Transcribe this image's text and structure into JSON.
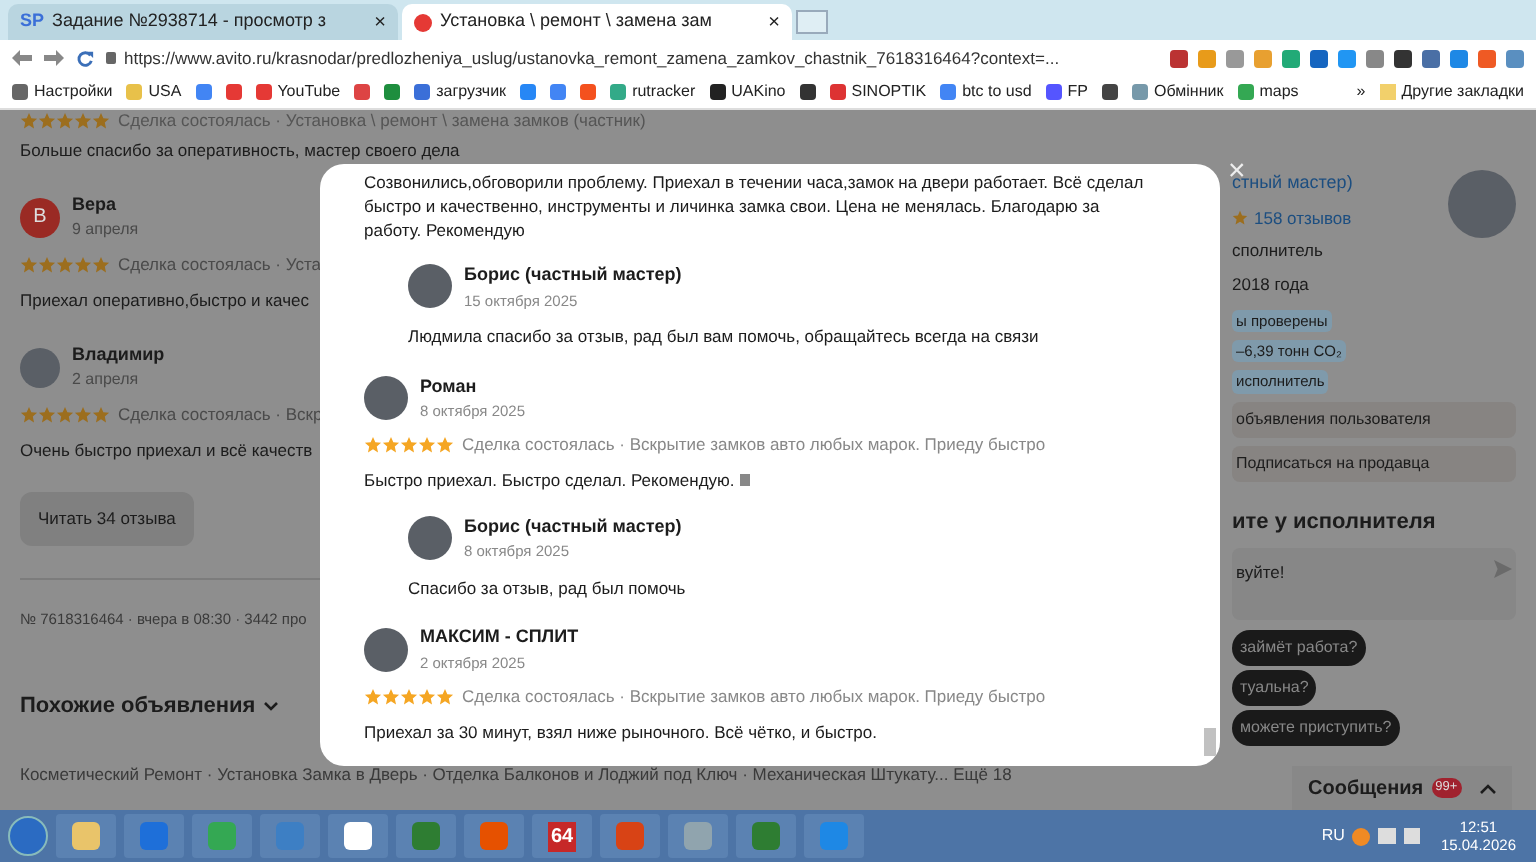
{
  "browser": {
    "tabs": [
      {
        "icon": "SP",
        "title": "Задание №2938714 - просмотр з",
        "close": "×",
        "selected": false
      },
      {
        "title": "Установка \\ ремонт \\ замена зам",
        "close": "×",
        "selected": true
      }
    ],
    "url": "https://www.avito.ru/krasnodar/predlozheniya_uslug/ustanovka_remont_zamena_zamkov_chastnik_7618316464?context=...",
    "bookmarks": [
      {
        "kind": "link",
        "label": "Настройки"
      },
      {
        "kind": "link",
        "label": "USA"
      },
      {
        "kind": "icon"
      },
      {
        "kind": "icon"
      },
      {
        "kind": "link",
        "label": "YouTube"
      },
      {
        "kind": "icon"
      },
      {
        "kind": "icon"
      },
      {
        "kind": "link",
        "label": "загрузчик"
      },
      {
        "kind": "icon"
      },
      {
        "kind": "icon"
      },
      {
        "kind": "icon"
      },
      {
        "kind": "link",
        "label": "rutracker"
      },
      {
        "kind": "link",
        "label": "UAKino"
      },
      {
        "kind": "icon"
      },
      {
        "kind": "link",
        "label": "SINOPTIK"
      },
      {
        "kind": "link",
        "label": "btc to usd"
      },
      {
        "kind": "link",
        "label": "FP"
      },
      {
        "kind": "icon"
      },
      {
        "kind": "link",
        "label": "Обмінник"
      },
      {
        "kind": "link",
        "label": "maps"
      }
    ],
    "more_bookmarks": "»",
    "other_bookmarks": "Другие закладки"
  },
  "page": {
    "top_review": {
      "stars": 5,
      "deal": "Сделка состоялась · Установка \\ ремонт \\ замена замков (частник)",
      "text": "Больше спасибо за оперативность, мастер своего дела"
    },
    "reviews": [
      {
        "initial": "В",
        "name": "Вера",
        "date": "9 апреля",
        "stars": 5,
        "deal": "Сделка состоялась · Уста",
        "text": "Приехал оперативно,быстро и качес"
      },
      {
        "name": "Владимир",
        "date": "2 апреля",
        "stars": 5,
        "deal": "Сделка состоялась · Вскр",
        "text": "Очень быстро приехал и всё качеств"
      }
    ],
    "read_all": "Читать 34 отзыва",
    "meta": "№ 7618316464 · вчера в 08:30 · 3442 про",
    "similar": "Похожие объявления",
    "similar_links": "Косметический Ремонт · Установка Замка в Дверь · Отделка Балконов и Лоджий под Ключ · Механическая Штукату... Ещё 18",
    "seller": {
      "name": "стный мастер)",
      "rating_count": "158 отзывов",
      "role": "сполнитель",
      "since": "2018 года",
      "badges": [
        "ы проверены",
        "–6,39 тонн CO₂",
        "исполнитель"
      ],
      "buttons": [
        "объявления пользователя",
        "Подписаться на продавца"
      ]
    },
    "ask": {
      "title": "ите у исполнителя",
      "message": "вуйте!",
      "questions": [
        "займёт работа?",
        "туальна?",
        "можете приступить?"
      ]
    },
    "messages": {
      "label": "Сообщения",
      "count": "99+"
    }
  },
  "modal": {
    "close": "×",
    "first_text": "Созвонились,обговорили проблему. Приехал в течении часа,замок на двери работает. Всё сделал быстро и качественно, инструменты и личинка замка свои. Цена не менялась. Благодарю за работу. Рекомендую",
    "first_reply": {
      "name": "Борис (частный мастер)",
      "date": "15 октября 2025",
      "text": "Людмила спасибо за отзыв, рад был вам помочь, обращайтесь всегда на связи"
    },
    "reviews": [
      {
        "name": "Роман",
        "date": "8 октября 2025",
        "stars": 5,
        "deal": "Сделка состоялась · Вскрытие замков авто любых марок. Приеду быстро",
        "text": "Быстро приехал. Быстро сделал. Рекомендую.",
        "reply": {
          "name": "Борис (частный мастер)",
          "date": "8 октября 2025",
          "text": "Спасибо за отзыв, рад был помочь"
        }
      },
      {
        "name": "МАКСИМ - СПЛИТ",
        "date": "2 октября 2025",
        "stars": 5,
        "deal": "Сделка состоялась · Вскрытие замков авто любых марок. Приеду быстро",
        "text": "Приехал за 30 минут, взял ниже рыночного. Всё чётко, и быстро."
      }
    ]
  },
  "taskbar": {
    "badge_app": "64",
    "language": "RU",
    "time": "12:51",
    "date": "15.04.2026"
  }
}
